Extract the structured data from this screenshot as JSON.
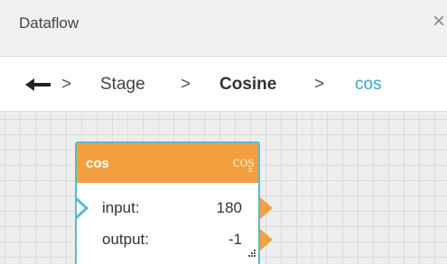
{
  "panel": {
    "title": "Dataflow",
    "close_icon": "close-icon"
  },
  "breadcrumb": {
    "back_icon": "back-arrow-icon",
    "separator": ">",
    "items": [
      "Stage",
      "Cosine",
      "cos"
    ]
  },
  "node": {
    "title": "cos",
    "symbol_main": "cos",
    "symbol_sub": "x",
    "header_color": "#f2a03f",
    "border_color": "#5bb9d3",
    "ports": [
      {
        "label": "input:",
        "value": "180"
      },
      {
        "label": "output:",
        "value": "-1"
      }
    ]
  }
}
